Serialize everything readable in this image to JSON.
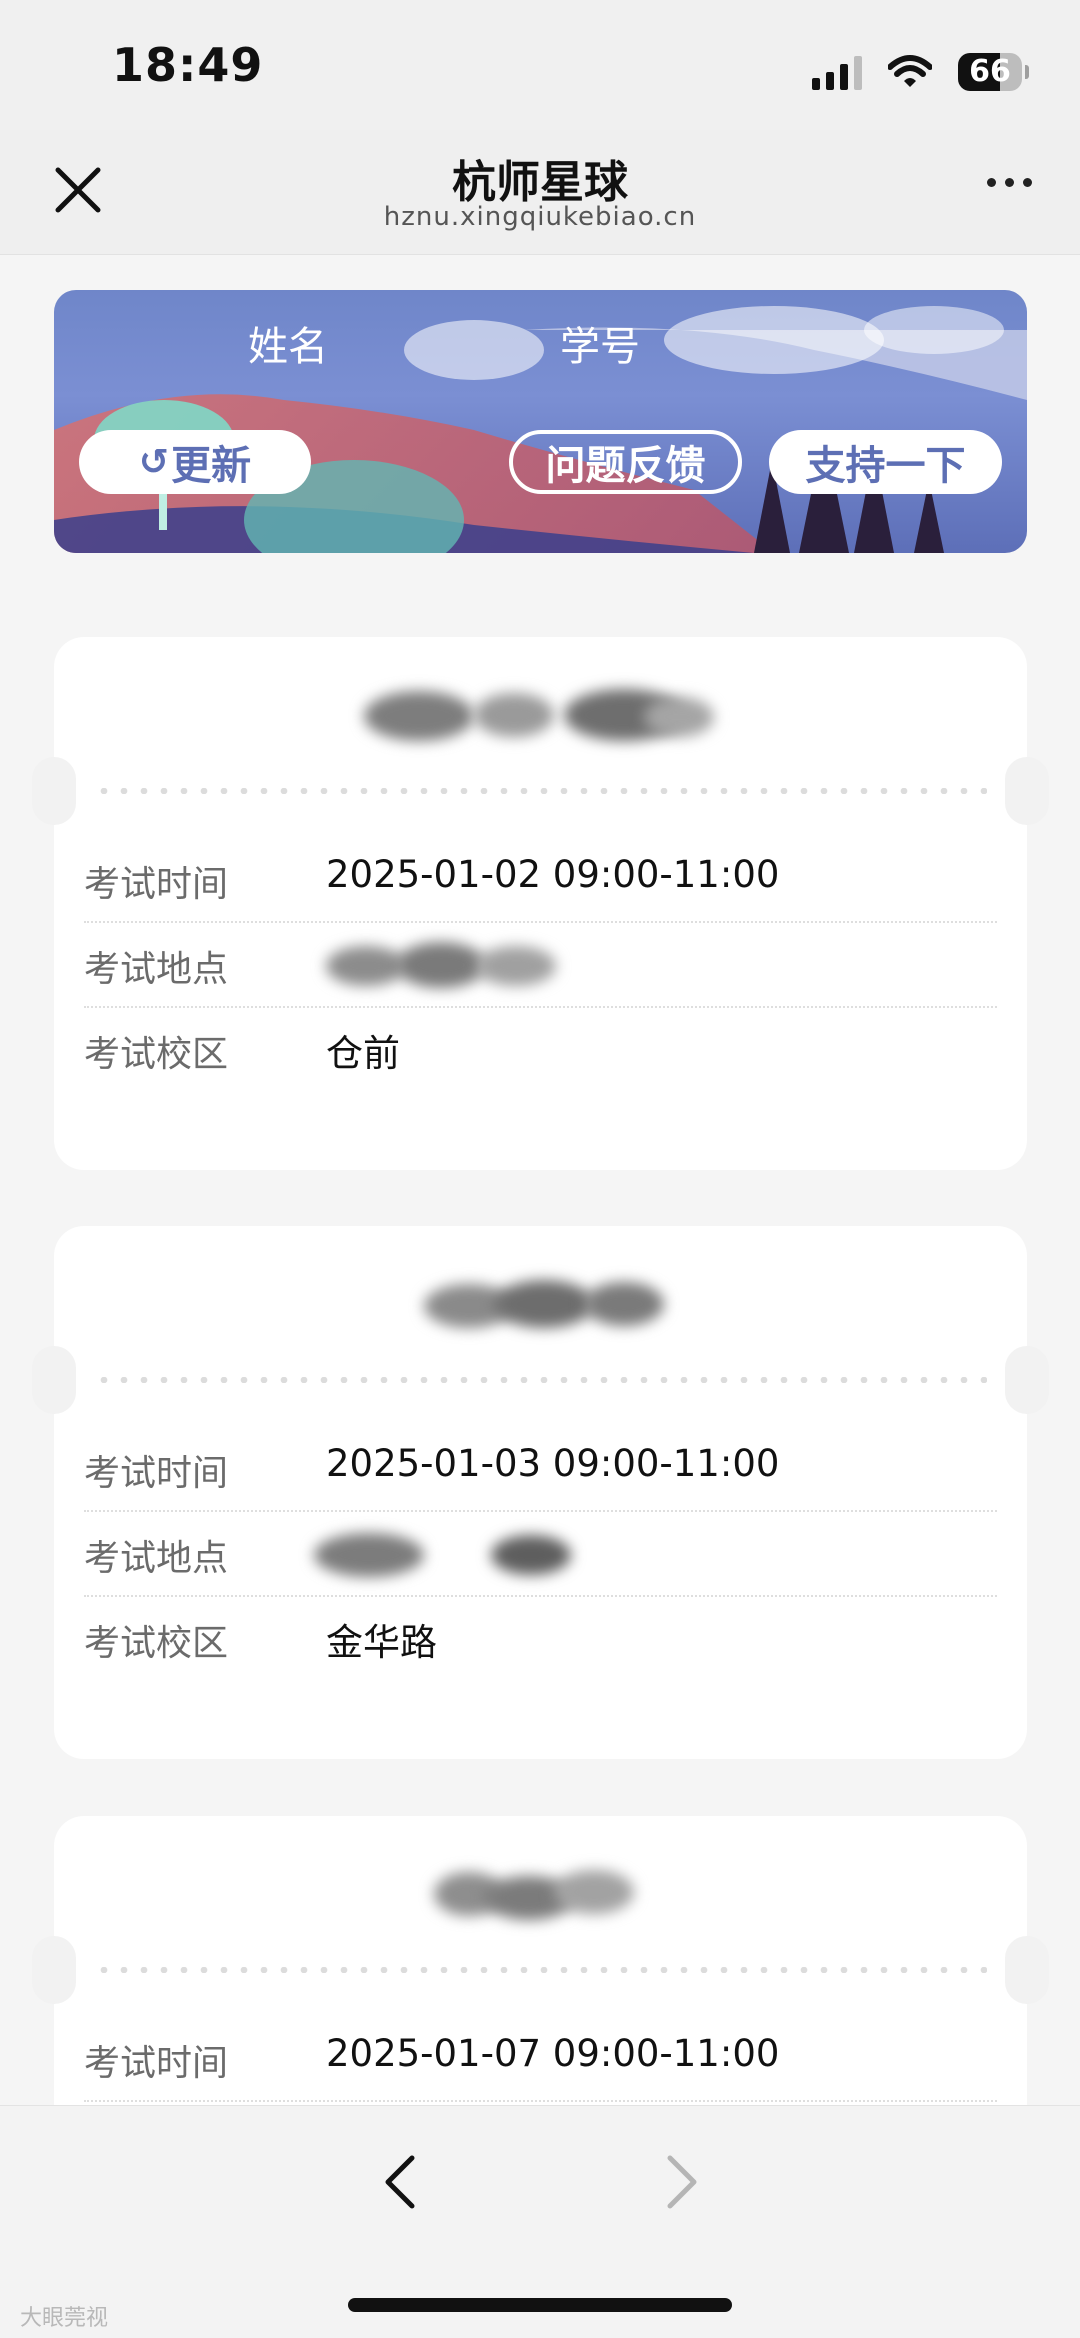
{
  "status_bar": {
    "time": "18:49",
    "battery": "66"
  },
  "nav": {
    "title": "杭师星球",
    "url": "hznu.xingqiukebiao.cn"
  },
  "banner": {
    "name_label": "姓名",
    "id_label": "学号",
    "refresh_label": "更新",
    "feedback_label": "问题反馈",
    "support_label": "支持一下"
  },
  "exams": [
    {
      "time_label": "考试时间",
      "time": "2025-01-02 09:00-11:00",
      "place_label": "考试地点",
      "campus_label": "考试校区",
      "campus": "仓前"
    },
    {
      "time_label": "考试时间",
      "time": "2025-01-03 09:00-11:00",
      "place_label": "考试地点",
      "campus_label": "考试校区",
      "campus": "金华路"
    },
    {
      "time_label": "考试时间",
      "time": "2025-01-07 09:00-11:00"
    }
  ],
  "watermark": "大眼莞视"
}
